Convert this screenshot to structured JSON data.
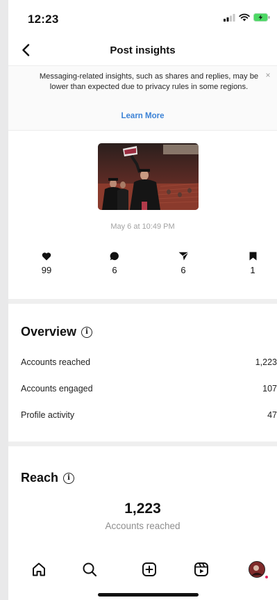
{
  "status_bar": {
    "time": "12:23"
  },
  "nav": {
    "title": "Post insights"
  },
  "notice": {
    "text": "Messaging-related insights, such as shares and replies, may be lower than expected due to privacy rules in some regions.",
    "link": "Learn More",
    "close": "×"
  },
  "post": {
    "date": "May 6 at 10:49 PM"
  },
  "stats": {
    "likes": "99",
    "comments": "6",
    "shares": "6",
    "saves": "1"
  },
  "overview": {
    "title": "Overview",
    "rows": [
      {
        "label": "Accounts reached",
        "value": "1,223"
      },
      {
        "label": "Accounts engaged",
        "value": "107"
      },
      {
        "label": "Profile activity",
        "value": "47"
      }
    ]
  },
  "reach": {
    "title": "Reach",
    "value": "1,223",
    "caption": "Accounts reached"
  },
  "info_glyph": "i",
  "colors": {
    "link": "#3b82d6",
    "battery": "#4cd964",
    "notification_dot": "#e0245e"
  },
  "icons": {
    "stats": [
      "heart-icon",
      "comment-icon",
      "share-icon",
      "bookmark-icon"
    ],
    "tabs": [
      "home-icon",
      "search-icon",
      "create-icon",
      "reels-icon",
      "profile-avatar"
    ]
  }
}
